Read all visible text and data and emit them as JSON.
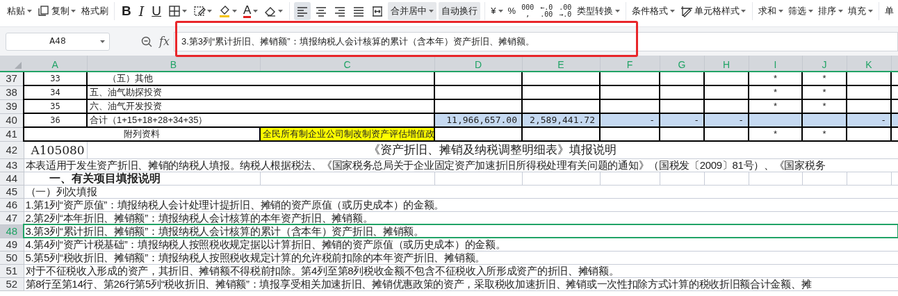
{
  "toolbar": {
    "items": [
      {
        "kind": "text",
        "label": "粘贴",
        "dropdown": true
      },
      {
        "kind": "copy",
        "label": "复制",
        "dropdown": true
      },
      {
        "kind": "text",
        "label": "格式刷"
      },
      {
        "kind": "separator"
      },
      {
        "kind": "bold",
        "label": "B"
      },
      {
        "kind": "italic",
        "label": "I"
      },
      {
        "kind": "underline",
        "label": "U"
      },
      {
        "kind": "borders",
        "dropdown": true
      },
      {
        "kind": "cell-format",
        "dropdown": true
      },
      {
        "kind": "fill-bucket",
        "dropdown": true
      },
      {
        "kind": "font-color",
        "label": "A",
        "dropdown": true
      },
      {
        "kind": "eraser",
        "dropdown": true
      },
      {
        "kind": "separator"
      },
      {
        "kind": "align-left",
        "selected": true
      },
      {
        "kind": "align-center",
        "selected": false
      },
      {
        "kind": "align-right",
        "selected": false
      },
      {
        "kind": "justify",
        "selected": false
      },
      {
        "kind": "distribute",
        "selected": false
      },
      {
        "kind": "boxed",
        "label": "合并居中",
        "dropdown": true
      },
      {
        "kind": "boxed",
        "label": "自动换行"
      },
      {
        "kind": "separator"
      },
      {
        "kind": "text",
        "label": "¥",
        "dropdown": true
      },
      {
        "kind": "text",
        "label": "%"
      },
      {
        "kind": "stacked",
        "lines": [
          "000",
          ","
        ]
      },
      {
        "kind": "stacked",
        "lines": [
          "←.0",
          ".00"
        ]
      },
      {
        "kind": "stacked",
        "lines": [
          ".00",
          "→.0"
        ]
      },
      {
        "kind": "text",
        "label": "类型转换",
        "dropdown": true
      },
      {
        "kind": "separator"
      },
      {
        "kind": "text",
        "label": "条件格式",
        "dropdown": true
      },
      {
        "kind": "cell-style",
        "label": "单元格样式",
        "dropdown": true
      },
      {
        "kind": "separator"
      },
      {
        "kind": "text",
        "label": "求和",
        "dropdown": true
      },
      {
        "kind": "text",
        "label": "筛选",
        "dropdown": true
      },
      {
        "kind": "text",
        "label": "排序",
        "dropdown": true
      },
      {
        "kind": "text",
        "label": "填充",
        "dropdown": true
      },
      {
        "kind": "separator"
      },
      {
        "kind": "text",
        "label": "单"
      }
    ]
  },
  "formula_bar": {
    "name_box": "A48",
    "fx": "fx",
    "formula": "3.第3列“累计折旧、摊销额”：填报纳税人会计核算的累计（含本年）资产折旧、摊销额。",
    "highlighted": true
  },
  "columns": [
    "A",
    "B",
    "C",
    "D",
    "E",
    "F",
    "G",
    "H",
    "I",
    "J",
    "K"
  ],
  "rows": [
    {
      "number": "37",
      "selected": false,
      "kind": "item",
      "cells": [
        {
          "kind": "label",
          "text": "33"
        },
        {
          "kind": "sub-label",
          "text": "（五）其他"
        },
        {
          "kind": "empty"
        },
        {
          "kind": "empty"
        },
        {
          "kind": "empty"
        },
        {
          "kind": "empty"
        },
        {
          "kind": "empty"
        },
        {
          "kind": "mark",
          "text": "*"
        },
        {
          "kind": "mark",
          "text": "*"
        },
        {
          "kind": "empty"
        }
      ]
    },
    {
      "number": "38",
      "selected": false,
      "kind": "item",
      "cells": [
        {
          "kind": "label",
          "text": "34"
        },
        {
          "kind": "label",
          "text": "五、油气勘探投资"
        },
        {
          "kind": "empty"
        },
        {
          "kind": "empty"
        },
        {
          "kind": "empty"
        },
        {
          "kind": "empty"
        },
        {
          "kind": "empty"
        },
        {
          "kind": "mark",
          "text": "*"
        },
        {
          "kind": "mark",
          "text": "*"
        },
        {
          "kind": "empty"
        }
      ]
    },
    {
      "number": "39",
      "selected": false,
      "kind": "item",
      "cells": [
        {
          "kind": "label",
          "text": "35"
        },
        {
          "kind": "label",
          "text": "六、油气开发投资"
        },
        {
          "kind": "empty"
        },
        {
          "kind": "empty"
        },
        {
          "kind": "empty"
        },
        {
          "kind": "empty"
        },
        {
          "kind": "empty"
        },
        {
          "kind": "mark",
          "text": "*"
        },
        {
          "kind": "mark",
          "text": "*"
        },
        {
          "kind": "empty"
        }
      ]
    },
    {
      "number": "40",
      "selected": false,
      "kind": "item",
      "cells": [
        {
          "kind": "label",
          "text": "36"
        },
        {
          "kind": "label",
          "text": "合计（1+15+18+28+34+35）"
        },
        {
          "kind": "number",
          "text": "11,966,657.00",
          "shaded": true
        },
        {
          "kind": "number",
          "text": "2,589,441.72",
          "shaded": true
        },
        {
          "kind": "number",
          "text": "-",
          "shaded": true
        },
        {
          "kind": "number",
          "text": "-",
          "shaded": true
        },
        {
          "kind": "number",
          "text": "-",
          "shaded": true
        },
        {
          "kind": "empty",
          "shaded": true
        },
        {
          "kind": "empty",
          "shaded": true
        },
        {
          "kind": "number",
          "text": "-",
          "shaded": true
        }
      ]
    },
    {
      "number": "41",
      "selected": false,
      "kind": "appendix",
      "cells": [
        {
          "kind": "caption",
          "text": "附列资料"
        },
        {
          "kind": "note",
          "text": "全民所有制企业公司制改制资产评估增值政",
          "highlighted": true
        },
        {
          "kind": "empty"
        },
        {
          "kind": "empty"
        },
        {
          "kind": "empty"
        },
        {
          "kind": "empty"
        },
        {
          "kind": "empty"
        },
        {
          "kind": "mark",
          "text": "*"
        },
        {
          "kind": "mark",
          "text": "*"
        },
        {
          "kind": "empty"
        }
      ]
    },
    {
      "number": "42",
      "selected": false,
      "kind": "title",
      "code": "A105080",
      "text": "《资产折旧、摊销及纳税调整明细表》填报说明"
    },
    {
      "number": "43",
      "selected": false,
      "kind": "text",
      "text": "本表适用于发生资产折旧、摊销的纳税人填报。纳税人根据税法、《国家税务总局关于企业固定资产加速折旧所得税处理有关问题的通知》（国税发〔2009〕81号）、《国家税务"
    },
    {
      "number": "44",
      "selected": false,
      "kind": "heading",
      "text": "一、有关项目填报说明"
    },
    {
      "number": "45",
      "selected": false,
      "kind": "text",
      "text": "（一）列次填报"
    },
    {
      "number": "46",
      "selected": false,
      "kind": "text",
      "text": "1.第1列“资产原值”：填报纳税人会计处理计提折旧、摊销的资产原值（或历史成本）的金额。"
    },
    {
      "number": "47",
      "selected": false,
      "kind": "text",
      "text": "2.第2列“本年折旧、摊销额”：填报纳税人会计核算的本年资产折旧、摊销额。"
    },
    {
      "number": "48",
      "selected": true,
      "kind": "text",
      "text": "3.第3列“累计折旧、摊销额”：填报纳税人会计核算的累计（含本年）资产折旧、摊销额。"
    },
    {
      "number": "49",
      "selected": false,
      "kind": "text",
      "text": "4.第4列“资产计税基础”：填报纳税人按照税收规定据以计算折旧、摊销的资产原值（或历史成本）的金额。"
    },
    {
      "number": "50",
      "selected": false,
      "kind": "text",
      "text": "5.第5列“税收折旧、摊销额”：填报纳税人按照税收规定计算的允许税前扣除的本年资产折旧、摊销额。"
    },
    {
      "number": "51",
      "selected": false,
      "kind": "text",
      "text": "对于不征税收入形成的资产，其折旧、摊销额不得税前扣除。第4列至第8列税收金额不包含不征税收入所形成资产的折旧、摊销额。"
    },
    {
      "number": "52",
      "selected": false,
      "kind": "text",
      "text": "第8行至第14行、第26行第5列“税收折旧、摊销额”：填报享受相关加速折旧、摊销优惠政策的资产，采取税收加速折旧、摊销或一次性扣除方式计算的税收折旧额合计金额、摊"
    }
  ]
}
